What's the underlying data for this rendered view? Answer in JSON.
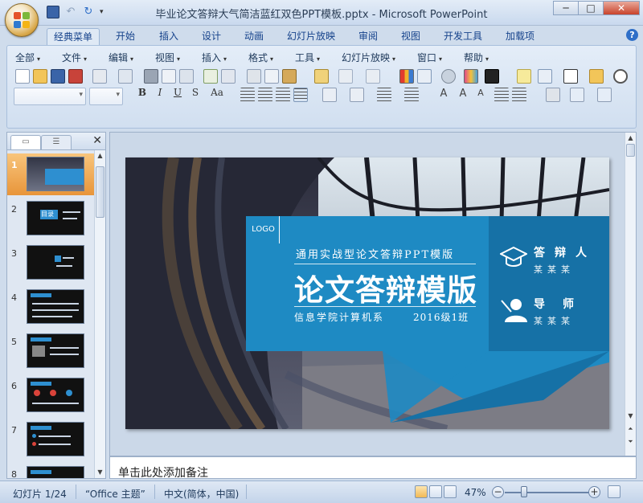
{
  "window": {
    "title": "毕业论文答辩大气简洁蓝红双色PPT模板.pptx - Microsoft PowerPoint",
    "min_label": "─",
    "max_label": "□",
    "close_label": "✕"
  },
  "ribbon_tabs": [
    "经典菜单",
    "开始",
    "插入",
    "设计",
    "动画",
    "幻灯片放映",
    "审阅",
    "视图",
    "开发工具",
    "加载项"
  ],
  "menus": [
    "全部",
    "文件",
    "编辑",
    "视图",
    "插入",
    "格式",
    "工具",
    "幻灯片放映",
    "窗口",
    "帮助"
  ],
  "format_buttons": [
    "B",
    "I",
    "U",
    "S",
    "Aa"
  ],
  "help_label": "?",
  "left_pane": {
    "tab_slides": "▭",
    "tab_outline": "☰",
    "close_label": "✕",
    "thumbnails": [
      "1",
      "2",
      "3",
      "4",
      "5",
      "6",
      "7",
      "8"
    ]
  },
  "slide": {
    "logo": "LOGO",
    "subtitle": "通用实战型论文答辩PPT模版",
    "title": "论文答辩模版",
    "department": "信息学院计算机系",
    "class": "2016级1班",
    "roles": [
      {
        "title": "答辩人",
        "name": "某某某"
      },
      {
        "title": "导师",
        "name": "某某某"
      }
    ],
    "thumb2_label": "目录"
  },
  "notes_placeholder": "单击此处添加备注",
  "status": {
    "slide_info": "幻灯片 1/24",
    "theme": "“Office 主题”",
    "language": "中文(简体，中国)",
    "zoom": "47%",
    "zoom_out": "−",
    "zoom_in": "+"
  },
  "colors": {
    "slide_blue": "#1e8ac3",
    "slide_dark_blue": "#1671a6",
    "selection_orange": "#e8953a"
  }
}
